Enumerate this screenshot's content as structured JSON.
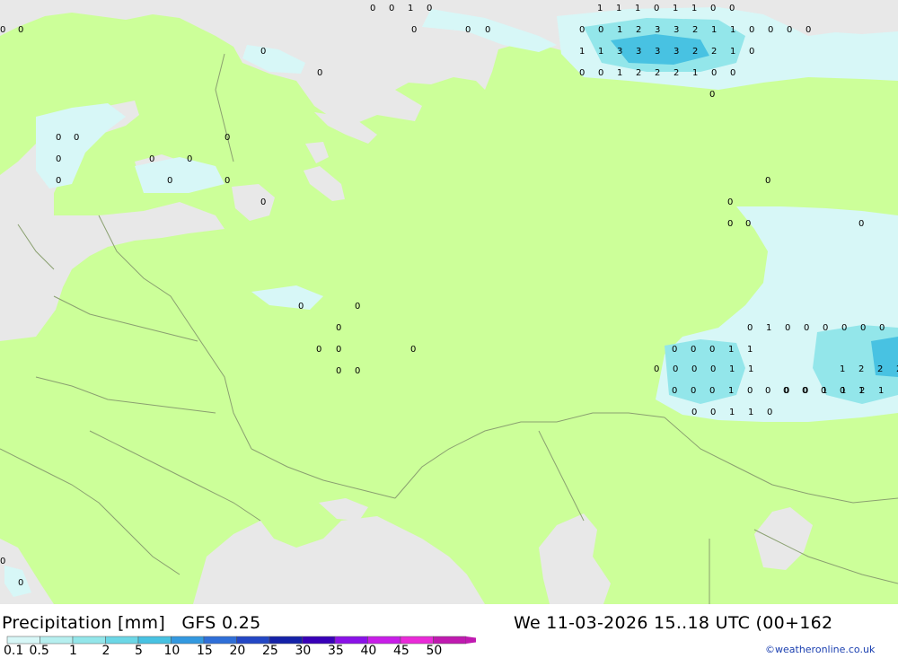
{
  "header": {
    "product": "Precipitation [mm]",
    "model": "GFS 0.25",
    "valid_time": "We 11-03-2026 15..18 UTC (00+162",
    "credit": "©weatheronline.co.uk"
  },
  "legend": {
    "labels": [
      "0.1",
      "0.5",
      "1",
      "2",
      "5",
      "10",
      "15",
      "20",
      "25",
      "30",
      "35",
      "40",
      "45",
      "50"
    ],
    "colors": [
      "#d7f7f7",
      "#b6efef",
      "#93e6ea",
      "#6cd7e6",
      "#48c2e2",
      "#3399e0",
      "#2f6fd8",
      "#2347c5",
      "#1421a8",
      "#3800b8",
      "#8a12e8",
      "#c81ee8",
      "#ea2ad8",
      "#c01ab0"
    ]
  },
  "map": {
    "land_color": "#ccff99",
    "sea_color": "#e8e8e8",
    "border_color": "#8aa070",
    "point_values": [
      {
        "v": "0",
        "x": 0,
        "y": 0
      },
      {
        "v": "0",
        "x": 0,
        "y": 0
      },
      {
        "v": "0",
        "x": 0,
        "y": 0
      },
      {
        "v": "0",
        "x": 0,
        "y": 0
      }
    ],
    "value_rows": [
      "0 0 1 0",
      "1 1 1 0 1 1 0 0",
      "0 0 1 2 3 3 2 1 1 0 0 0 0",
      "1 1 3 3 3 3 2 2 1 0",
      "0 0 1 2 2 2 1 0 0",
      "0 0 0 1 1",
      "0 0 0 0 1 1",
      "0 0 0 1 0",
      "0 0 1 1 0",
      "0 0 0 0 1",
      "0 1 0 0 0 0 0 0 1",
      "0 0 0 1 1 2 1",
      "1 2 2 2"
    ]
  }
}
